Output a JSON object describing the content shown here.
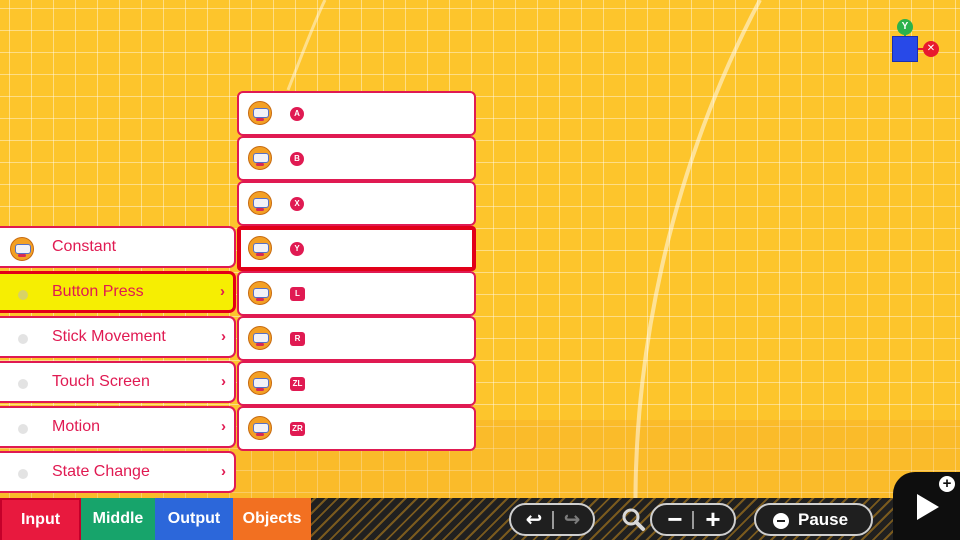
{
  "gizmo": {
    "y_axis": "Y",
    "x_axis": "✕",
    "colors": {
      "y": "#2bb24c",
      "x": "#e8192e",
      "object": "#2849e8"
    }
  },
  "category_menu": {
    "items": [
      {
        "label": "Constant",
        "icon": "nodon-face-icon",
        "has_submenu": false,
        "selected": false
      },
      {
        "label": "Button Press",
        "icon": "dot",
        "has_submenu": true,
        "selected": true
      },
      {
        "label": "Stick Movement",
        "icon": "dot",
        "has_submenu": true,
        "selected": false
      },
      {
        "label": "Touch Screen",
        "icon": "dot",
        "has_submenu": true,
        "selected": false
      },
      {
        "label": "Motion",
        "icon": "dot",
        "has_submenu": true,
        "selected": false
      },
      {
        "label": "State Change",
        "icon": "dot",
        "has_submenu": true,
        "selected": false
      }
    ],
    "chevron": "›"
  },
  "button_menu": {
    "items": [
      {
        "badge": "A",
        "icon": "nodon-face-icon",
        "selected": false
      },
      {
        "badge": "B",
        "icon": "nodon-face-icon",
        "selected": false
      },
      {
        "badge": "X",
        "icon": "nodon-face-icon",
        "selected": false
      },
      {
        "badge": "Y",
        "icon": "nodon-face-icon",
        "selected": true
      },
      {
        "badge": "L",
        "icon": "nodon-face-icon",
        "selected": false
      },
      {
        "badge": "R",
        "icon": "nodon-face-icon",
        "selected": false
      },
      {
        "badge": "ZL",
        "icon": "nodon-face-icon",
        "selected": false
      },
      {
        "badge": "ZR",
        "icon": "nodon-face-icon",
        "selected": false
      }
    ]
  },
  "tabs": {
    "input": "Input",
    "middle": "Middle",
    "output": "Output",
    "objects": "Objects",
    "active": "Input",
    "colors": {
      "input": "#e8193e",
      "middle": "#17a46b",
      "output": "#2c67da",
      "objects": "#f27021"
    }
  },
  "toolbar": {
    "undo_icon": "↩",
    "redo_icon": "↪",
    "zoom_icon": "magnifier-icon",
    "zoom_out": "−",
    "zoom_in": "+",
    "pause_label": "Pause"
  },
  "play_button": {
    "icon": "play-icon",
    "plus": "+"
  },
  "colors": {
    "background": "#fdc52c",
    "accent": "#e01a52",
    "selected_highlight": "#f6ee02"
  }
}
